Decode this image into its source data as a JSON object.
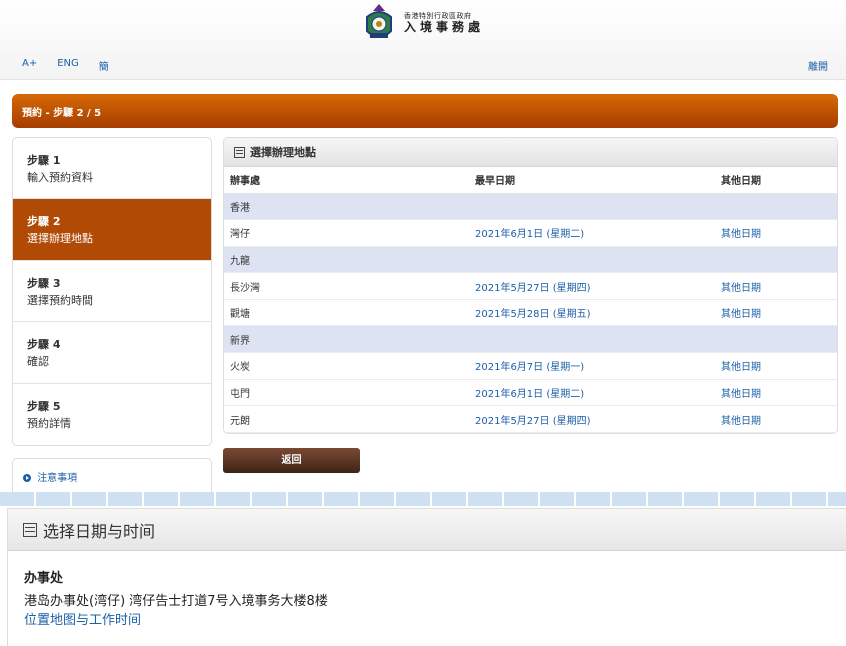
{
  "header": {
    "logo_line1": "香港特別行政區政府",
    "logo_line2": "入境事務處",
    "links": [
      "A+",
      "ENG",
      "簡"
    ],
    "exit": "離開"
  },
  "stepbar": {
    "title": "預約 - 步驟 2 / 5"
  },
  "steps": [
    {
      "num": "步驟 1",
      "desc": "輸入預約資料"
    },
    {
      "num": "步驟 2",
      "desc": "選擇辦理地點"
    },
    {
      "num": "步驟 3",
      "desc": "選擇預約時間"
    },
    {
      "num": "步驟 4",
      "desc": "確認"
    },
    {
      "num": "步驟 5",
      "desc": "預約詳情"
    }
  ],
  "notes": {
    "label": "注意事項"
  },
  "panel": {
    "title": "選擇辦理地點",
    "columns": [
      "辦事處",
      "最早日期",
      "其他日期"
    ],
    "rows": [
      {
        "region": "香港"
      },
      {
        "office": "灣仔",
        "date": "2021年6月1日 (星期二)",
        "other": "其他日期"
      },
      {
        "region": "九龍"
      },
      {
        "office": "長沙灣",
        "date": "2021年5月27日 (星期四)",
        "other": "其他日期"
      },
      {
        "office": "觀塘",
        "date": "2021年5月28日 (星期五)",
        "other": "其他日期"
      },
      {
        "region": "新界"
      },
      {
        "office": "火炭",
        "date": "2021年6月7日 (星期一)",
        "other": "其他日期"
      },
      {
        "office": "屯門",
        "date": "2021年6月1日 (星期二)",
        "other": "其他日期"
      },
      {
        "office": "元朗",
        "date": "2021年5月27日 (星期四)",
        "other": "其他日期"
      }
    ]
  },
  "back_button": "返回",
  "lower": {
    "title": "选择日期与时间",
    "office_label": "办事处",
    "office_address": "港岛办事处(湾仔) 湾仔告士打道7号入境事务大楼8楼",
    "map_link": "位置地图与工作时间"
  }
}
